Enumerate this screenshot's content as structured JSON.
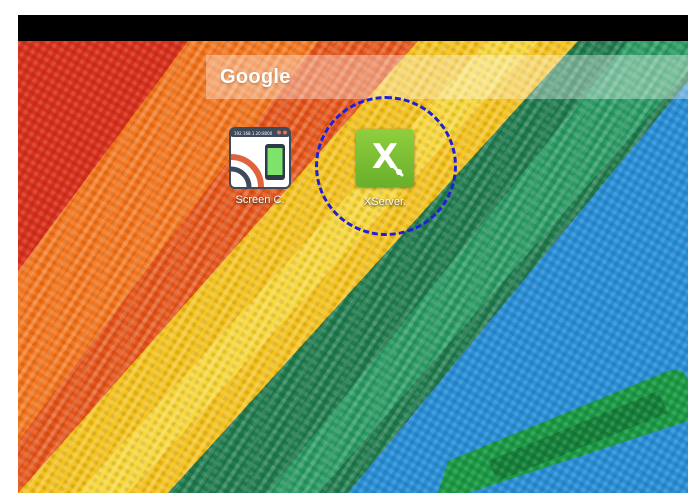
{
  "status_bar": {},
  "search": {
    "logo_text": "Google"
  },
  "apps": [
    {
      "label": "Screen C.",
      "icon": "screen-cast-icon",
      "mini_url": "192.168.1.20:8000"
    },
    {
      "label": "XServer.",
      "icon": "xserver-icon",
      "letter": "X"
    }
  ],
  "annotation": {
    "type": "dashed-circle",
    "color": "#1f1fd6",
    "target": "XServer."
  },
  "wallpaper": {
    "subject": "colorful-zippers",
    "colors": [
      "#d62e20",
      "#f47a1f",
      "#f2c21a",
      "#1e7d52",
      "#2a8ed1"
    ]
  }
}
